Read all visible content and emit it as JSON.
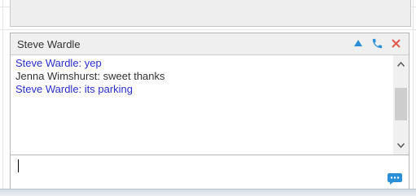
{
  "chat": {
    "title": "Steve Wardle",
    "messages": [
      {
        "sender": "Steve Wardle",
        "text": "Steve Wardle: yep",
        "color": "#2a2fcc"
      },
      {
        "sender": "Jenna Wimshurst",
        "text": "Jenna Wimshurst: sweet thanks",
        "color": "#333333"
      },
      {
        "sender": "Steve Wardle",
        "text": "Steve Wardle: its parking",
        "color": "#2a2fcc"
      }
    ],
    "input": {
      "value": "",
      "placeholder": ""
    }
  },
  "icons": {
    "minimize": "triangle-up-icon",
    "call": "phone-icon",
    "close": "close-icon",
    "scroll_up": "chevron-up-icon",
    "scroll_down": "chevron-down-icon",
    "send": "chat-bubble-icon"
  },
  "colors": {
    "accent_blue": "#2a8fd6",
    "close_red": "#e05a4e",
    "own_message": "#2a2fcc",
    "other_message": "#333333"
  }
}
